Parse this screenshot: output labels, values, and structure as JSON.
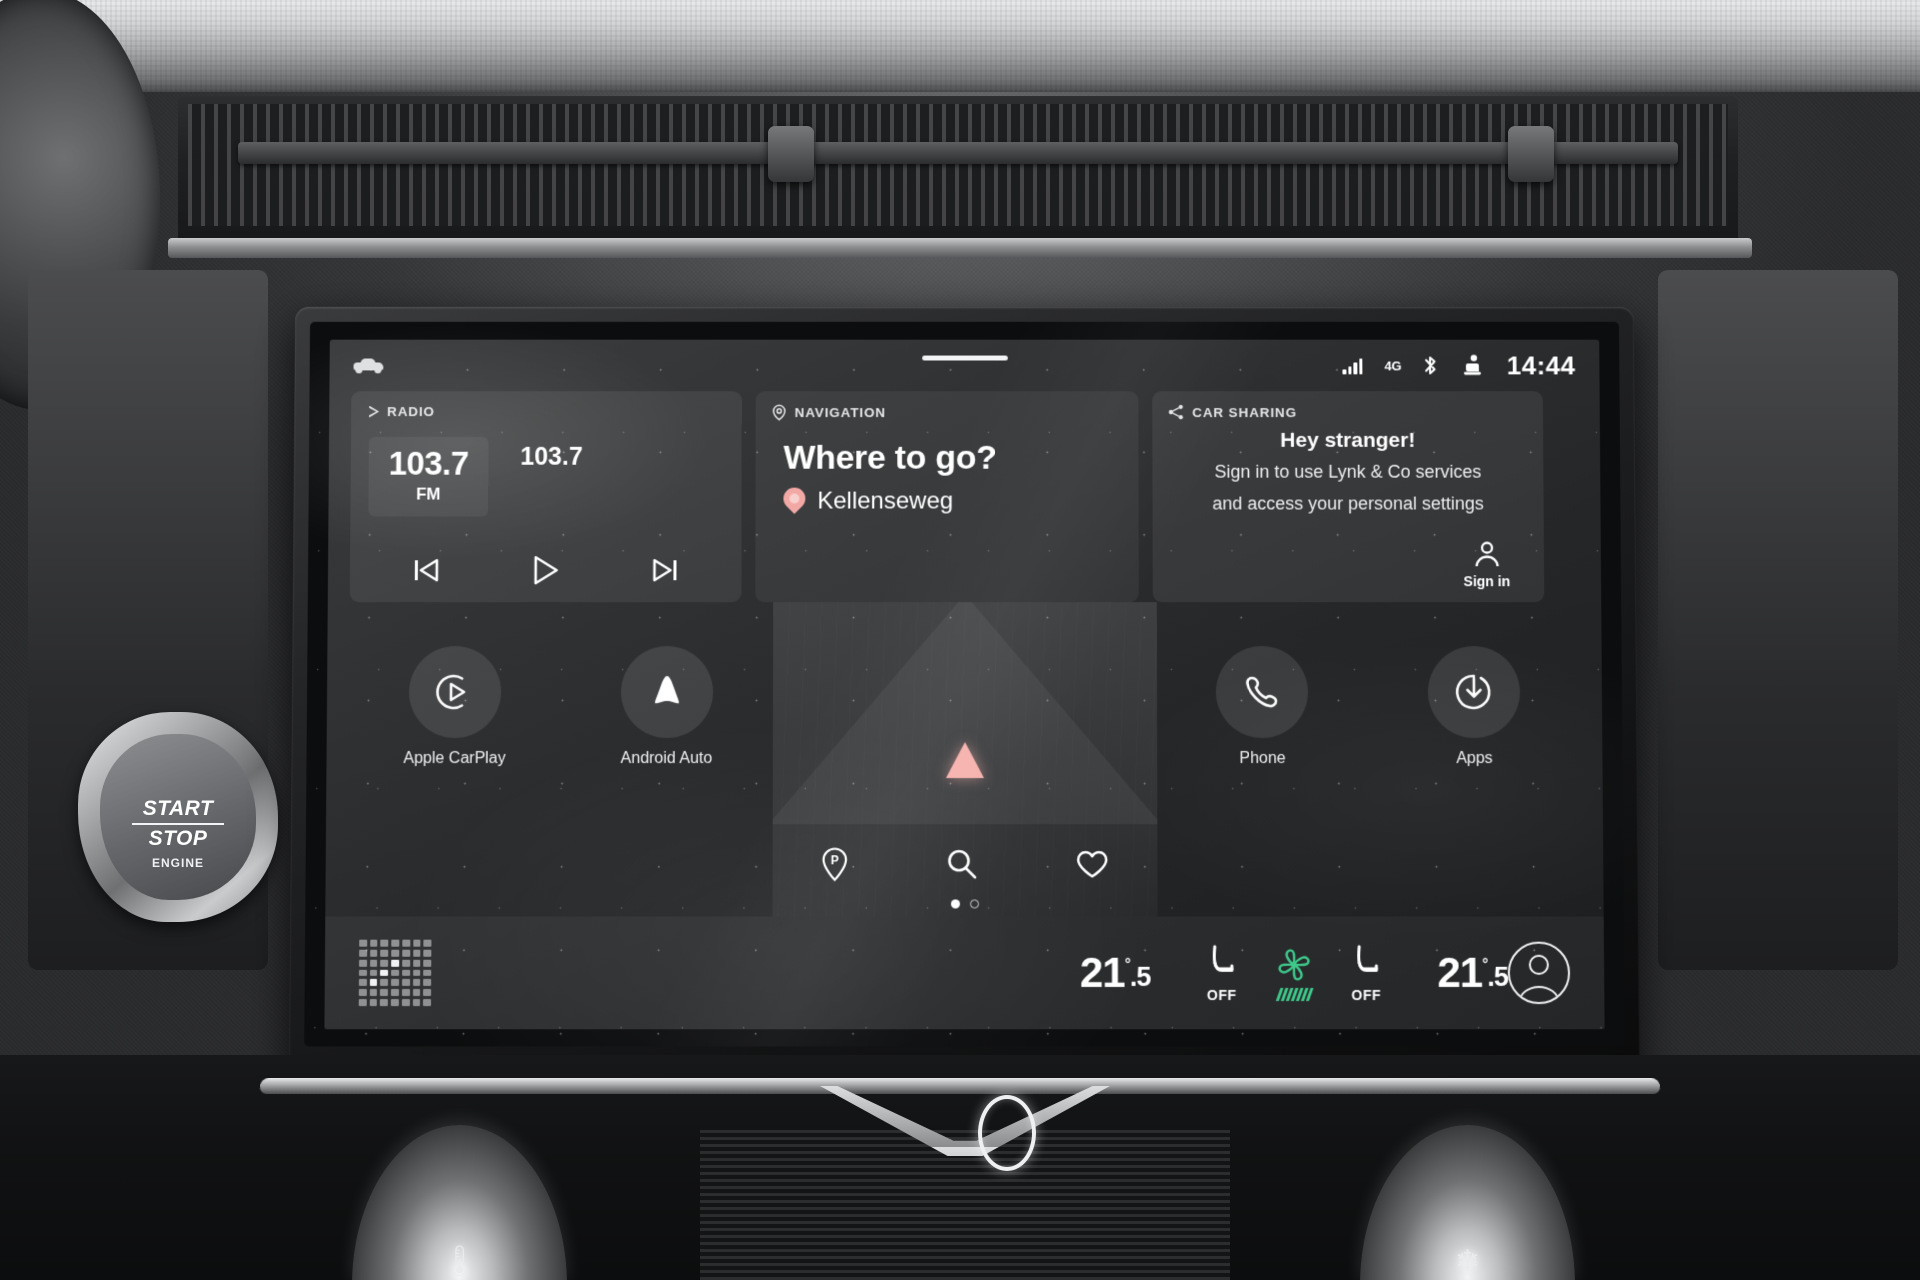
{
  "vehicle": {
    "start_stop": {
      "line1": "START",
      "line2": "STOP",
      "line3": "ENGINE"
    }
  },
  "screen": {
    "statusbar": {
      "vehicle_icon": "car-icon",
      "pulldown_handle": "drag-handle",
      "signal_icon": "cellular-signal-icon",
      "network": "4G",
      "bluetooth_icon": "bluetooth-icon",
      "seatbelt_icon": "seat-occupant-icon",
      "time": "14:44"
    },
    "cards": {
      "radio": {
        "header": "RADIO",
        "header_icon": "play-triangle-icon",
        "frequency": "103.7",
        "band": "FM",
        "station_name": "103.7",
        "prev_icon": "skip-previous-icon",
        "play_icon": "play-icon",
        "next_icon": "skip-next-icon"
      },
      "navigation": {
        "header": "NAVIGATION",
        "header_icon": "location-pin-icon",
        "title": "Where to go?",
        "destination": "Kellenseweg",
        "destination_icon": "map-pin-icon"
      },
      "car_sharing": {
        "header": "CAR SHARING",
        "header_icon": "share-icon",
        "title": "Hey stranger!",
        "body_line1": "Sign in to use Lynk & Co services",
        "body_line2": "and access your personal settings",
        "signin_label": "Sign in",
        "signin_icon": "person-icon"
      }
    },
    "apps": {
      "left": [
        {
          "label": "Apple CarPlay",
          "icon": "carplay-icon"
        },
        {
          "label": "Android Auto",
          "icon": "android-auto-icon"
        }
      ],
      "right": [
        {
          "label": "Phone",
          "icon": "phone-handset-icon"
        },
        {
          "label": "Apps",
          "icon": "apps-power-icon"
        }
      ]
    },
    "map": {
      "heading_arrow_icon": "vehicle-heading-arrow-icon",
      "tools": [
        {
          "icon": "parking-pin-icon",
          "name": "parking"
        },
        {
          "icon": "search-icon",
          "name": "search"
        },
        {
          "icon": "heart-icon",
          "name": "favourites"
        }
      ],
      "page_dots": {
        "total": 2,
        "active_index": 0
      }
    },
    "climate": {
      "matrix_icon": "seat-ventilation-matrix-icon",
      "left_temp": {
        "whole": "21",
        "decimal": ".5",
        "degree": "°"
      },
      "right_temp": {
        "whole": "21",
        "decimal": ".5",
        "degree": "°"
      },
      "left_seat": {
        "icon": "seat-heater-icon",
        "state": "OFF"
      },
      "right_seat": {
        "icon": "seat-heater-icon",
        "state": "OFF"
      },
      "fan": {
        "icon": "fan-icon",
        "color": "#3fc98a"
      },
      "profile_icon": "user-avatar-icon"
    }
  },
  "colors": {
    "accent_pink": "#f6b3ae",
    "fan_green": "#3fc98a",
    "text_primary": "#ffffff"
  }
}
